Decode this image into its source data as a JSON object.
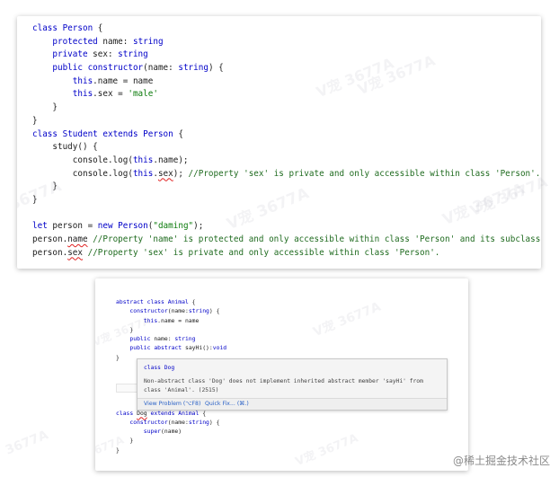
{
  "snippet1": {
    "lines": [
      [
        {
          "t": "class ",
          "c": "k"
        },
        {
          "t": "Person",
          "c": "k"
        },
        {
          "t": " {"
        }
      ],
      [
        {
          "t": "    "
        },
        {
          "t": "protected ",
          "c": "k"
        },
        {
          "t": "name: "
        },
        {
          "t": "string",
          "c": "k"
        }
      ],
      [
        {
          "t": "    "
        },
        {
          "t": "private ",
          "c": "k"
        },
        {
          "t": "sex: "
        },
        {
          "t": "string",
          "c": "k"
        }
      ],
      [
        {
          "t": "    "
        },
        {
          "t": "public ",
          "c": "k"
        },
        {
          "t": "constructor",
          "c": "k"
        },
        {
          "t": "(name: "
        },
        {
          "t": "string",
          "c": "k"
        },
        {
          "t": ") {"
        }
      ],
      [
        {
          "t": "        "
        },
        {
          "t": "this",
          "c": "k"
        },
        {
          "t": ".name = name"
        }
      ],
      [
        {
          "t": "        "
        },
        {
          "t": "this",
          "c": "k"
        },
        {
          "t": ".sex = "
        },
        {
          "t": "'male'",
          "c": "s"
        }
      ],
      [
        {
          "t": "    }"
        }
      ],
      [
        {
          "t": "}"
        }
      ],
      [
        {
          "t": "class ",
          "c": "k"
        },
        {
          "t": "Student ",
          "c": "k"
        },
        {
          "t": "extends ",
          "c": "k"
        },
        {
          "t": "Person",
          "c": "k"
        },
        {
          "t": " {"
        }
      ],
      [
        {
          "t": "    study() {"
        }
      ],
      [
        {
          "t": "        console.log("
        },
        {
          "t": "this",
          "c": "k"
        },
        {
          "t": ".name);"
        }
      ],
      [
        {
          "t": "        console.log("
        },
        {
          "t": "this",
          "c": "k"
        },
        {
          "t": "."
        },
        {
          "t": "sex",
          "c": "err"
        },
        {
          "t": "); "
        },
        {
          "t": "//Property 'sex' is private and only accessible within class 'Person'.",
          "c": "c"
        }
      ],
      [
        {
          "t": "    }"
        }
      ],
      [
        {
          "t": "}"
        }
      ],
      [
        {
          "t": ""
        }
      ],
      [
        {
          "t": "let ",
          "c": "k"
        },
        {
          "t": "person = "
        },
        {
          "t": "new ",
          "c": "k"
        },
        {
          "t": "Person",
          "c": "k"
        },
        {
          "t": "("
        },
        {
          "t": "\"daming\"",
          "c": "s"
        },
        {
          "t": ");"
        }
      ],
      [
        {
          "t": "person."
        },
        {
          "t": "name",
          "c": "err"
        },
        {
          "t": " "
        },
        {
          "t": "//Property 'name' is protected and only accessible within class 'Person' and its subclasses.",
          "c": "c"
        }
      ],
      [
        {
          "t": "person."
        },
        {
          "t": "sex",
          "c": "err"
        },
        {
          "t": " "
        },
        {
          "t": "//Property 'sex' is private and only accessible within class 'Person'.",
          "c": "c"
        }
      ]
    ]
  },
  "snippet2": {
    "lines": [
      [
        {
          "t": "abstract ",
          "c": "k"
        },
        {
          "t": "class ",
          "c": "k"
        },
        {
          "t": "Animal",
          "c": "k"
        },
        {
          "t": " {"
        }
      ],
      [
        {
          "t": "    "
        },
        {
          "t": "constructor",
          "c": "k"
        },
        {
          "t": "(name:"
        },
        {
          "t": "string",
          "c": "k"
        },
        {
          "t": ") {"
        }
      ],
      [
        {
          "t": "        "
        },
        {
          "t": "this",
          "c": "k"
        },
        {
          "t": ".name = name"
        }
      ],
      [
        {
          "t": "    }"
        }
      ],
      [
        {
          "t": "    "
        },
        {
          "t": "public ",
          "c": "k"
        },
        {
          "t": "name: "
        },
        {
          "t": "string",
          "c": "k"
        }
      ],
      [
        {
          "t": "    "
        },
        {
          "t": "public ",
          "c": "k"
        },
        {
          "t": "abstract ",
          "c": "k"
        },
        {
          "t": "sayHi():"
        },
        {
          "t": "void",
          "c": "k"
        }
      ],
      [
        {
          "t": "}"
        }
      ],
      [
        {
          "t": ""
        }
      ],
      [
        {
          "t": ""
        }
      ],
      [
        {
          "t": ""
        }
      ],
      [
        {
          "t": ""
        }
      ],
      [
        {
          "t": ""
        }
      ],
      [
        {
          "t": "class ",
          "c": "k"
        },
        {
          "t": "Dog",
          "c": "err"
        },
        {
          "t": " "
        },
        {
          "t": "extends ",
          "c": "k"
        },
        {
          "t": "Animal",
          "c": "k"
        },
        {
          "t": " {"
        }
      ],
      [
        {
          "t": "    "
        },
        {
          "t": "constructor",
          "c": "k"
        },
        {
          "t": "(name:"
        },
        {
          "t": "string",
          "c": "k"
        },
        {
          "t": ") {"
        }
      ],
      [
        {
          "t": "        "
        },
        {
          "t": "super",
          "c": "k"
        },
        {
          "t": "(name)"
        }
      ],
      [
        {
          "t": "    }"
        }
      ],
      [
        {
          "t": "}"
        }
      ]
    ]
  },
  "tooltip": {
    "header": "class Dog",
    "message_line1": "Non-abstract class 'Dog' does not implement inherited abstract member 'sayHi' from",
    "message_line2": "class 'Animal'. (2515)",
    "view_problem_label": "View Problem (⌥F8)",
    "quick_fix_label": "Quick Fix... (⌘.)"
  },
  "watermarks": [
    "V宠 3677A",
    "V宠 3677A",
    "V宠 3677A",
    "V宠 3677A",
    "V宠 3677A",
    "V宠 3677A",
    "3677A",
    "V宠 3677A",
    "V宠 3677A",
    "3677A",
    "3677A"
  ],
  "footer": "@稀土掘金技术社区",
  "colors": {
    "keyword": "#0000c8",
    "string": "#0a7a0a",
    "comment": "#1f6b1f",
    "error_underline": "#e02020",
    "link": "#2b62c7"
  }
}
